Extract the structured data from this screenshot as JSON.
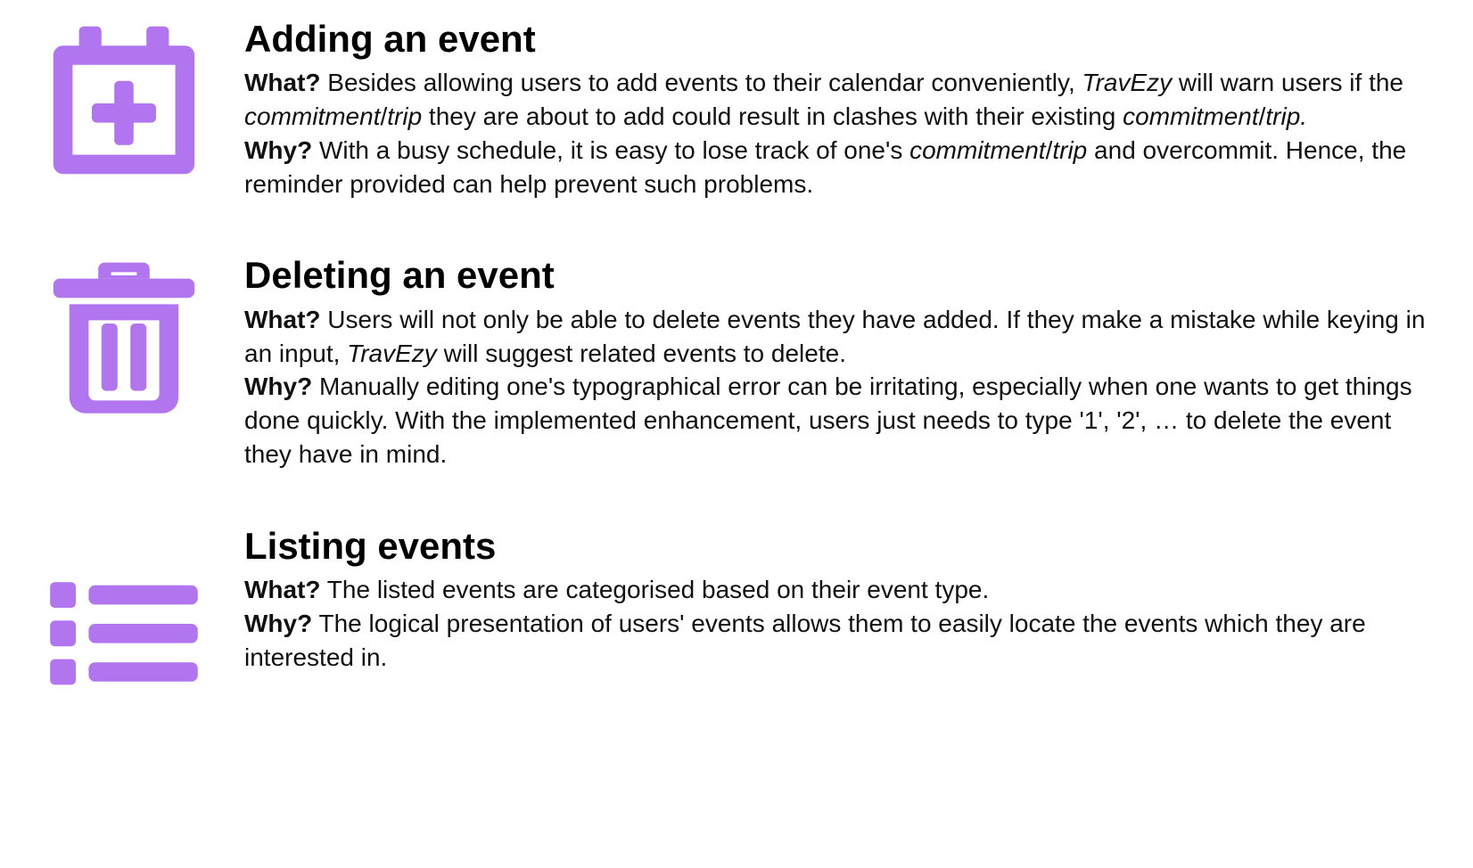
{
  "accent": "#b175f0",
  "app_name": "TravEzy",
  "sections": [
    {
      "id": "add",
      "heading": "Adding an event",
      "icon_name": "calendar-add-icon",
      "what_label": "What?",
      "why_label": "Why?",
      "what_parts": [
        {
          "t": " Besides allowing users to add events to their calendar conveniently, "
        },
        {
          "t": "TravEzy",
          "i": true
        },
        {
          "t": " will warn users if the "
        },
        {
          "t": "commitment",
          "i": true
        },
        {
          "t": "/"
        },
        {
          "t": "trip",
          "i": true
        },
        {
          "t": " they are about to add could result in clashes with their existing "
        },
        {
          "t": "commitment",
          "i": true
        },
        {
          "t": "/"
        },
        {
          "t": "trip.",
          "i": true
        }
      ],
      "why_parts": [
        {
          "t": " With a busy schedule, it is easy to lose track of one's "
        },
        {
          "t": "commitment",
          "i": true
        },
        {
          "t": "/"
        },
        {
          "t": "trip",
          "i": true
        },
        {
          "t": " and overcommit. Hence, the reminder provided can help prevent such problems."
        }
      ]
    },
    {
      "id": "delete",
      "heading": "Deleting an event",
      "icon_name": "trash-icon",
      "what_label": "What?",
      "why_label": "Why?",
      "what_parts": [
        {
          "t": " Users will not only be able to delete events they have added. If they make a mistake while keying in an input, "
        },
        {
          "t": "TravEzy",
          "i": true
        },
        {
          "t": " will suggest related events to delete."
        }
      ],
      "why_parts": [
        {
          "t": " Manually editing one's typographical error can be irritating, especially when one wants to get things done quickly. With the implemented enhancement, users just needs to type '1', '2', … to delete the event they have in mind."
        }
      ]
    },
    {
      "id": "list",
      "heading": "Listing events",
      "icon_name": "list-icon",
      "what_label": "What?",
      "why_label": "Why?",
      "what_parts": [
        {
          "t": " The listed events are categorised based on their event type."
        }
      ],
      "why_parts": [
        {
          "t": " The logical presentation of users' events allows them to easily locate the events which they are interested in."
        }
      ]
    }
  ]
}
